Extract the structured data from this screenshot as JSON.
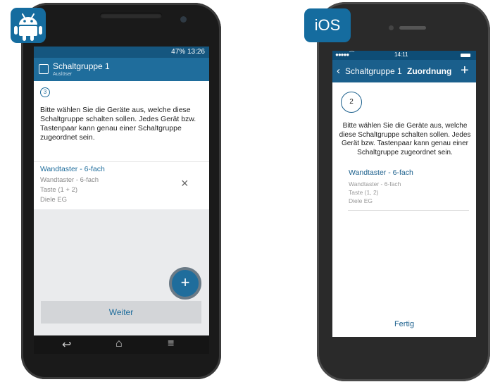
{
  "android": {
    "status_text": "47% 13:26",
    "appbar_title": "Schaltgruppe 1",
    "appbar_subtitle": "Auslöser",
    "step": "3",
    "description": "Bitte wählen Sie die Geräte aus, welche diese Schaltgruppe schalten sollen. Jedes Gerät bzw. Tastenpaar kann genau einer Schaltgruppe zugeordnet sein.",
    "item": {
      "title": "Wandtaster - 6-fach",
      "line1": "Wandtaster - 6-fach",
      "line2": "Taste (1 + 2)",
      "line3": "Diele EG"
    },
    "remove_icon": "×",
    "fab": "+",
    "next_button": "Weiter",
    "nav": {
      "back": "↩",
      "home": "⌂",
      "menu": "≡"
    }
  },
  "ios": {
    "badge": "iOS",
    "status_time": "14:11",
    "back_label": "Schaltgruppe 1",
    "title": "Zuordnung",
    "add": "+",
    "step": "2",
    "description": "Bitte wählen Sie die Geräte aus, welche diese Schaltgruppe schalten sollen. Jedes Gerät bzw. Tastenpaar kann genau einer Schaltgruppe zugeordnet sein.",
    "item": {
      "title": "Wandtaster - 6-fach",
      "line1": "Wandtaster - 6-fach",
      "line2": "Taste (1, 2)",
      "line3": "Diele EG"
    },
    "done_button": "Fertig"
  },
  "colors": {
    "accent": "#1f6d9c",
    "badge": "#156c9f",
    "grey_bg": "#eaebed"
  }
}
